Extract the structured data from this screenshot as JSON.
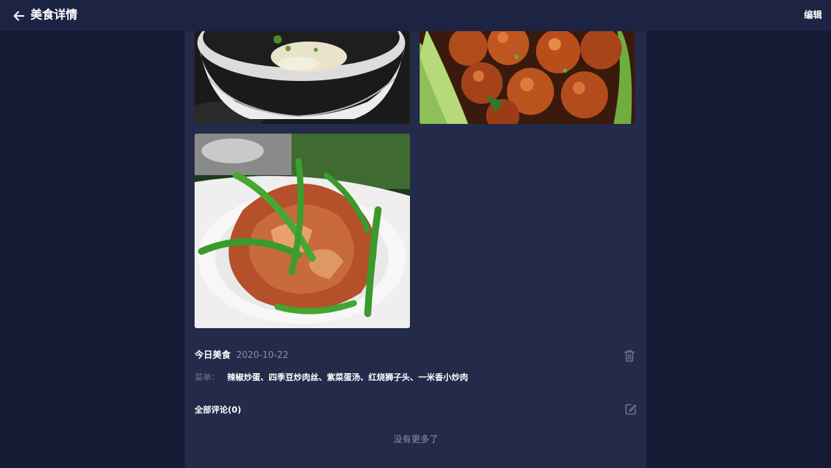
{
  "header": {
    "title": "美食详情",
    "edit_label": "编辑"
  },
  "photos": [
    {
      "alt": "紫菜蛋汤"
    },
    {
      "alt": "红烧狮子头"
    },
    {
      "alt": "一米香小炒肉"
    }
  ],
  "post": {
    "title": "今日美食",
    "date": "2020-10-22",
    "menu_label": "菜单：",
    "menu": "辣椒炒蛋、四季豆炒肉丝、紫菜蛋汤、红烧狮子头、一米香小炒肉"
  },
  "comments": {
    "title": "全部评论(0)",
    "empty_text": "没有更多了"
  },
  "icons": {
    "back": "arrow-left-icon",
    "delete": "trash-icon",
    "write_comment": "edit-square-icon"
  },
  "colors": {
    "page_bg": "#161a35",
    "topbar_bg": "#1d2342",
    "panel_bg": "#232a4a",
    "muted_text": "#8a8fa8"
  }
}
